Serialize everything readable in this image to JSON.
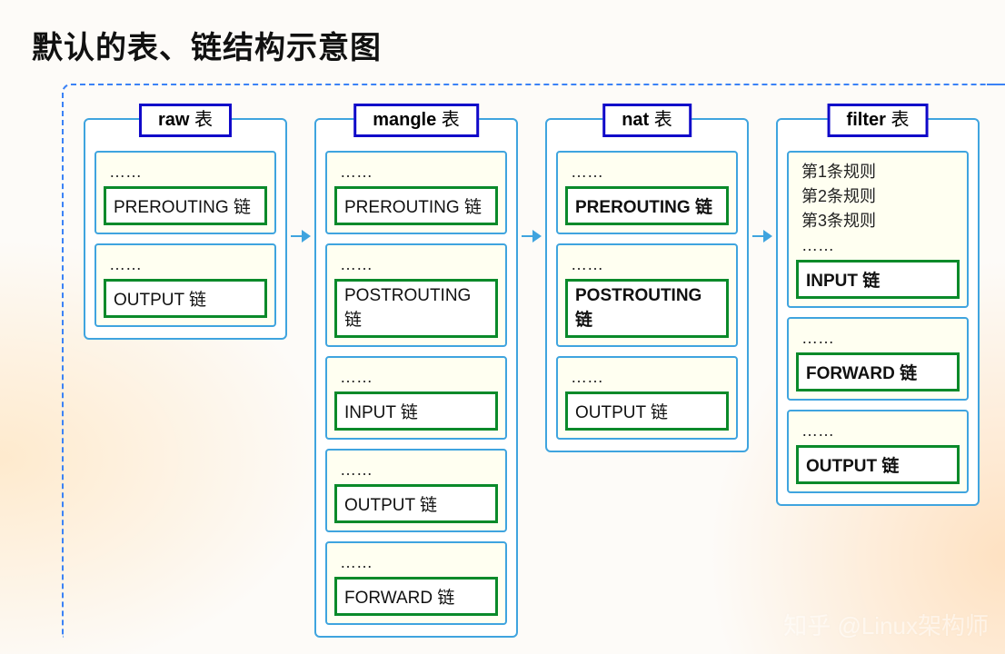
{
  "title": "默认的表、链结构示意图",
  "watermark": "知乎 @Linux架构师",
  "ellipsis": "……",
  "tables": {
    "raw": {
      "label_prefix": "raw",
      "label_suffix": " 表",
      "groups": [
        {
          "lines": [
            "……"
          ],
          "chain": "PREROUTING 链",
          "bold": false
        },
        {
          "lines": [
            "……"
          ],
          "chain": "OUTPUT 链",
          "bold": false
        }
      ]
    },
    "mangle": {
      "label_prefix": "mangle",
      "label_suffix": " 表",
      "groups": [
        {
          "lines": [
            "……"
          ],
          "chain": "PREROUTING 链",
          "bold": false
        },
        {
          "lines": [
            "……"
          ],
          "chain": "POSTROUTING 链",
          "bold": false
        },
        {
          "lines": [
            "……"
          ],
          "chain": "INPUT 链",
          "bold": false
        },
        {
          "lines": [
            "……"
          ],
          "chain": "OUTPUT 链",
          "bold": false
        },
        {
          "lines": [
            "……"
          ],
          "chain": "FORWARD 链",
          "bold": false
        }
      ]
    },
    "nat": {
      "label_prefix": "nat",
      "label_suffix": " 表",
      "groups": [
        {
          "lines": [
            "……"
          ],
          "chain": "PREROUTING 链",
          "bold": true
        },
        {
          "lines": [
            "……"
          ],
          "chain": "POSTROUTING 链",
          "bold": true
        },
        {
          "lines": [
            "……"
          ],
          "chain": "OUTPUT 链",
          "bold": false
        }
      ]
    },
    "filter": {
      "label_prefix": "filter",
      "label_suffix": " 表",
      "groups": [
        {
          "lines": [
            "第1条规则",
            "第2条规则",
            "第3条规则",
            "……"
          ],
          "chain": "INPUT 链",
          "bold": true
        },
        {
          "lines": [
            "……"
          ],
          "chain": "FORWARD 链",
          "bold": true
        },
        {
          "lines": [
            "……"
          ],
          "chain": "OUTPUT 链",
          "bold": true
        }
      ]
    }
  }
}
